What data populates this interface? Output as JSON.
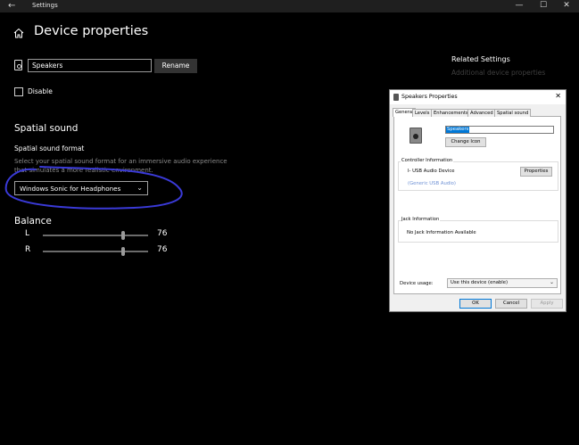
{
  "window": {
    "title": "Settings",
    "controls": {
      "minimize": "—",
      "maximize": "☐",
      "close": "✕"
    }
  },
  "page": {
    "title": "Device properties",
    "device_name_value": "Speakers",
    "rename_label": "Rename",
    "disable_label": "Disable",
    "disable_checked": false
  },
  "spatial": {
    "heading": "Spatial sound",
    "format_label": "Spatial sound format",
    "description": "Select your spatial sound format for an immersive audio experience that simulates a more realistic environment.",
    "selected_format": "Windows Sonic for Headphones",
    "annotation_color": "#3a3ad8"
  },
  "balance": {
    "heading": "Balance",
    "channels": [
      {
        "label": "L",
        "value": 76
      },
      {
        "label": "R",
        "value": 76
      }
    ]
  },
  "related": {
    "heading": "Related Settings",
    "link": "Additional device properties"
  },
  "dialog": {
    "title": "Speakers Properties",
    "close_glyph": "✕",
    "tabs": [
      "General",
      "Levels",
      "Enhancements",
      "Advanced",
      "Spatial sound"
    ],
    "active_tab": "General",
    "device_name": "Speakers",
    "change_icon_label": "Change Icon",
    "controller_group_label": "Controller Information",
    "controller_name": "I- USB Audio Device",
    "controller_sub": "(Generic USB Audio)",
    "properties_label": "Properties",
    "jack_group_label": "Jack Information",
    "jack_text": "No Jack Information Available",
    "usage_label": "Device usage:",
    "usage_value": "Use this device (enable)",
    "ok_label": "OK",
    "cancel_label": "Cancel",
    "apply_label": "Apply"
  }
}
